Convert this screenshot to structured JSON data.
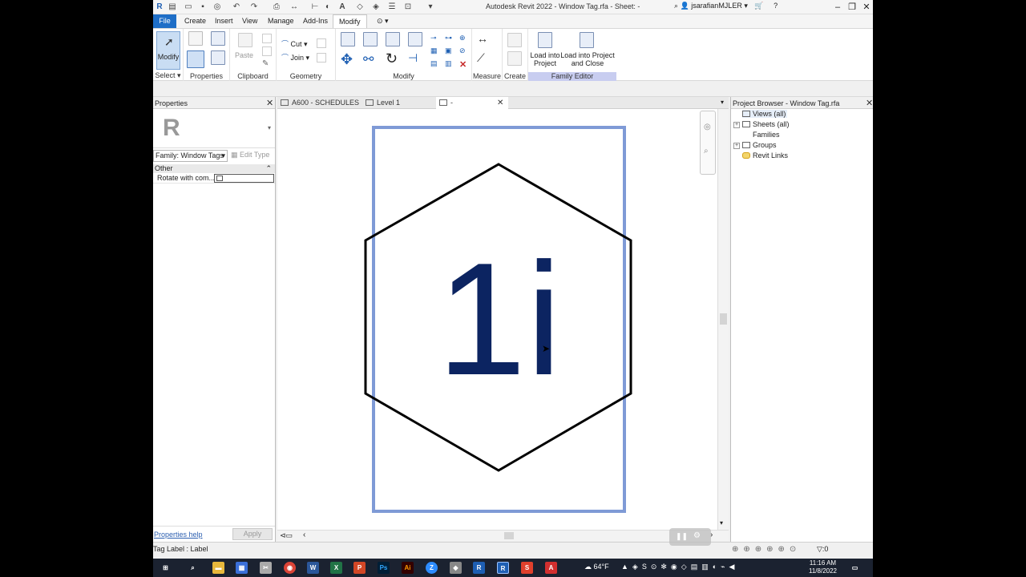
{
  "window": {
    "title": "Autodesk Revit 2022 - Window Tag.rfa - Sheet: -",
    "user": "jsarafianMJLER"
  },
  "ribbon_tabs": [
    "File",
    "Create",
    "Insert",
    "View",
    "Manage",
    "Add-Ins",
    "Modify"
  ],
  "ribbon": {
    "select_panel": "Select",
    "modify_label": "Modify",
    "properties_panel": "Properties",
    "clipboard_panel": "Clipboard",
    "paste_label": "Paste",
    "cut_label": "Cut",
    "join_label": "Join",
    "geometry_panel": "Geometry",
    "modify_panel": "Modify",
    "measure_panel": "Measure",
    "create_panel": "Create",
    "load_into_project": "Load into Project",
    "load_into_project_close": "Load into Project and Close",
    "family_editor_panel": "Family Editor"
  },
  "properties": {
    "title": "Properties",
    "family_selector": "Family: Window Tags",
    "edit_type": "Edit Type",
    "group_other": "Other",
    "row_label": "Rotate with com...",
    "help_link": "Properties help",
    "apply": "Apply"
  },
  "view_tabs": [
    {
      "label": "A600 - SCHEDULES"
    },
    {
      "label": "Level 1"
    },
    {
      "label": "-"
    }
  ],
  "canvas": {
    "tag_text": "1i",
    "text_color": "#0c2461",
    "frame_color": "#7f9ad6"
  },
  "project_browser": {
    "title": "Project Browser - Window Tag.rfa",
    "items": [
      "Views (all)",
      "Sheets (all)",
      "Families",
      "Groups",
      "Revit Links"
    ]
  },
  "status": {
    "text": "Tag Label : Label",
    "filter_count": ":0"
  },
  "taskbar": {
    "weather": "64°F",
    "time": "11:16 AM",
    "date": "11/8/2022"
  }
}
